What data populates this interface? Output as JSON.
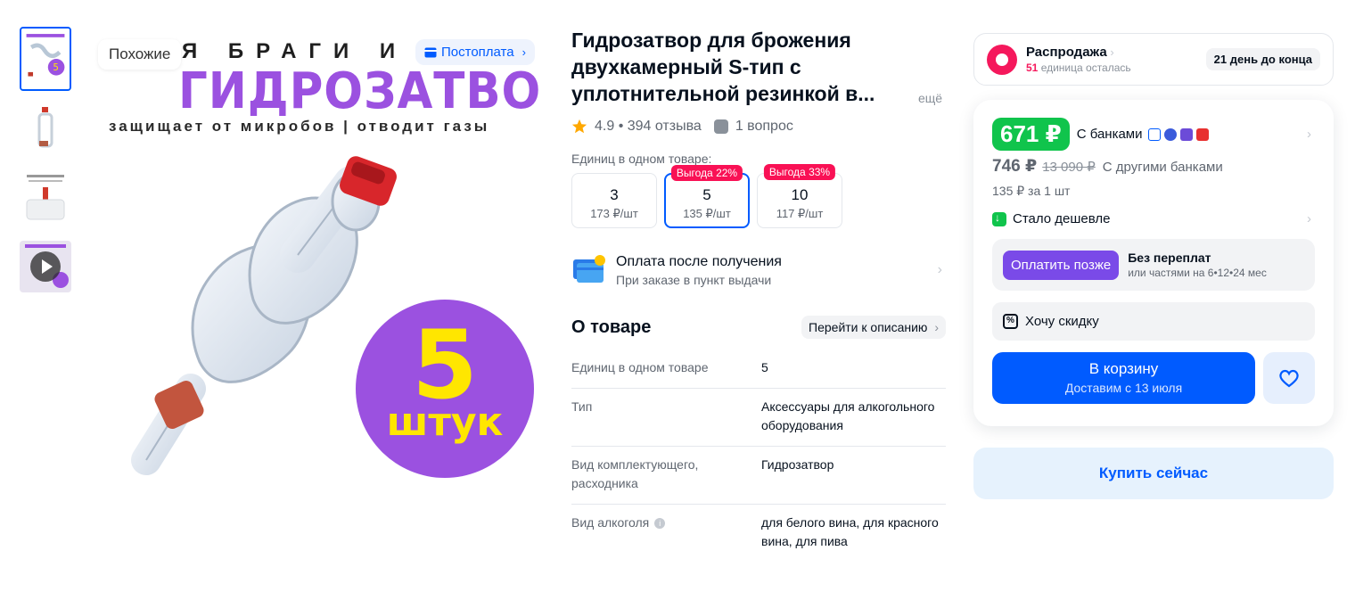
{
  "gallery": {
    "similar_label": "Похожие",
    "postpay_label": "Постоплата",
    "image_text": {
      "top_line": "Я БРАГИ И В",
      "title": "ГИДРОЗАТВОР",
      "subtitle": "защищает от микробов | отводит газы",
      "badge_number": "5",
      "badge_word": "штук"
    }
  },
  "product": {
    "title": "Гидрозатвор для брожения двухкамерный S-тип с уплотнительной резинкой в...",
    "more_label": "ещё",
    "rating": "4.9 • 394 отзыва",
    "questions": "1 вопрос",
    "units_label": "Единиц в одном товаре:",
    "variants": [
      {
        "qty": "3",
        "price": "173 ₽/шт",
        "badge": ""
      },
      {
        "qty": "5",
        "price": "135 ₽/шт",
        "badge": "Выгода 22%"
      },
      {
        "qty": "10",
        "price": "117 ₽/шт",
        "badge": "Выгода 33%"
      }
    ],
    "payment": {
      "title": "Оплата после получения",
      "subtitle": "При заказе в пункт выдачи"
    },
    "about": {
      "title": "О товаре",
      "goto_label": "Перейти к описанию",
      "attributes": [
        {
          "name": "Единиц в одном товаре",
          "value": "5"
        },
        {
          "name": "Тип",
          "value": "Аксессуары для алкогольного оборудования"
        },
        {
          "name": "Вид комплектующего, расходника",
          "value": "Гидрозатвор"
        },
        {
          "name": "Вид алкоголя",
          "value": "для белого вина, для красного вина, для пива"
        }
      ]
    }
  },
  "sale": {
    "title": "Распродажа",
    "remaining_count": "51",
    "remaining_text": " единица осталась",
    "days_left": "21 день до конца"
  },
  "buy": {
    "price_banks": "671 ₽",
    "banks_label": "С банками",
    "price_other": "746 ₽",
    "price_old": "13 090 ₽",
    "other_banks_label": "С другими банками",
    "per_unit": "135 ₽ за 1 шт",
    "cheaper_label": "Стало дешевле",
    "pay_later_button": "Оплатить позже",
    "pay_later_title": "Без переплат",
    "pay_later_sub": "или частями на 6•12•24 мес",
    "discount_label": "Хочу скидку",
    "cart_label": "В корзину",
    "cart_delivery": "Доставим с 13 июля",
    "buy_now_label": "Купить сейчас"
  },
  "colors": {
    "accent": "#005bff",
    "price_green": "#10c44c",
    "sale_pink": "#f91155",
    "pay_later_purple": "#7a4ae8",
    "image_purple": "#9b51e0",
    "image_yellow": "#ffe600"
  }
}
